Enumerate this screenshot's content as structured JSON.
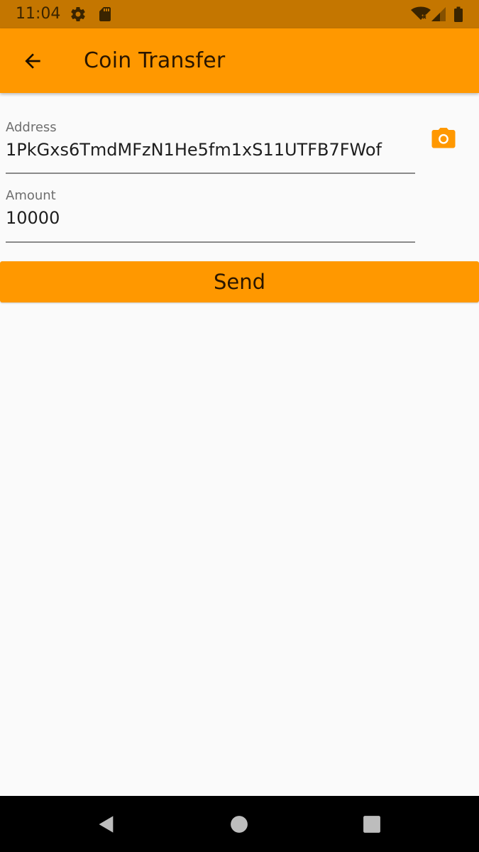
{
  "status_bar": {
    "time": "11:04",
    "icons": [
      "settings-icon",
      "sd-card-icon",
      "wifi-off-icon",
      "signal-icon",
      "battery-icon"
    ]
  },
  "app_bar": {
    "title": "Coin Transfer",
    "back_icon": "arrow-back-icon"
  },
  "form": {
    "address": {
      "label": "Address",
      "value": "1PkGxs6TmdMFzN1He5fm1xS11UTFB7FWof"
    },
    "amount": {
      "label": "Amount",
      "value": "10000"
    },
    "camera_icon": "camera-icon",
    "send_label": "Send"
  },
  "nav_bar": {
    "icons": [
      "nav-back-icon",
      "nav-home-icon",
      "nav-recents-icon"
    ]
  },
  "colors": {
    "status_bar": "#c47600",
    "app_bar": "#ff9800",
    "accent": "#ff9800",
    "background": "#fafafa",
    "nav_bar": "#000000"
  }
}
